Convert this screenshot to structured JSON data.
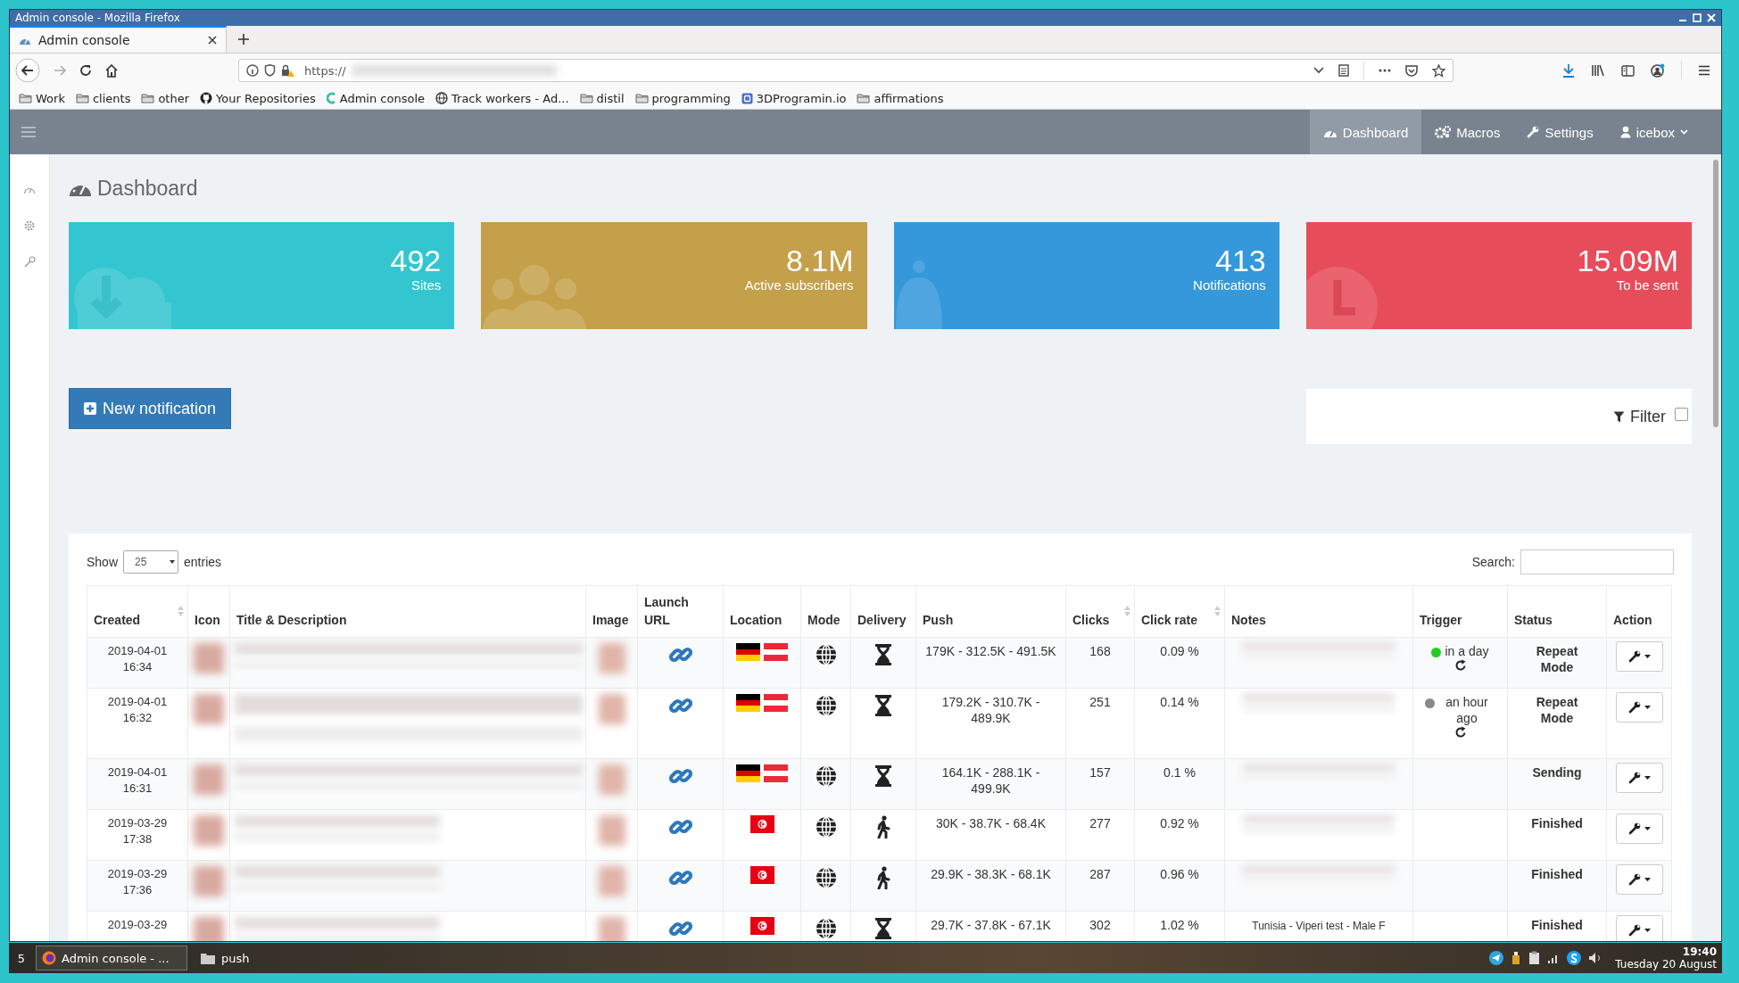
{
  "window": {
    "title": "Admin console - Mozilla Firefox"
  },
  "browser": {
    "tabs": [
      {
        "label": "Admin console",
        "selected": true
      }
    ],
    "url": "https://",
    "bookmarks": [
      {
        "label": "Work",
        "kind": "folder"
      },
      {
        "label": "clients",
        "kind": "folder"
      },
      {
        "label": "other",
        "kind": "folder"
      },
      {
        "label": "Your Repositories",
        "kind": "github"
      },
      {
        "label": "Admin console",
        "kind": "app"
      },
      {
        "label": "Track workers - Ad...",
        "kind": "globe"
      },
      {
        "label": "distil",
        "kind": "folder"
      },
      {
        "label": "programming",
        "kind": "folder"
      },
      {
        "label": "3DProgramin.io",
        "kind": "site"
      },
      {
        "label": "affirmations",
        "kind": "folder"
      }
    ]
  },
  "app": {
    "nav": [
      {
        "label": "Dashboard",
        "kind": "dashboard",
        "selected": true
      },
      {
        "label": "Macros",
        "kind": "macros",
        "selected": false
      },
      {
        "label": "Settings",
        "kind": "settings",
        "selected": false
      },
      {
        "label": "icebox",
        "kind": "user",
        "selected": false
      }
    ],
    "page_title": "Dashboard",
    "stats": [
      {
        "value": "492",
        "label": "Sites",
        "kind": "sites",
        "color": "#33c6d1"
      },
      {
        "value": "8.1M",
        "label": "Active subscribers",
        "kind": "subscribers",
        "color": "#c4a04a"
      },
      {
        "value": "413",
        "label": "Notifications",
        "kind": "notifications",
        "color": "#3498db"
      },
      {
        "value": "15.09M",
        "label": "To be sent",
        "kind": "queue",
        "color": "#e74c5a"
      }
    ],
    "new_button": "New notification",
    "filter": {
      "label": "Filter",
      "checked": false
    },
    "table": {
      "show_label": "Show",
      "page_size": "25",
      "entries_label": "entries",
      "search_label": "Search:",
      "columns": [
        {
          "label": "Created",
          "sortable": true
        },
        {
          "label": "Icon",
          "sortable": false
        },
        {
          "label": "Title & Description",
          "sortable": false
        },
        {
          "label": "Image",
          "sortable": false
        },
        {
          "label": "Launch URL",
          "sortable": false
        },
        {
          "label": "Location",
          "sortable": false
        },
        {
          "label": "Mode",
          "sortable": false
        },
        {
          "label": "Delivery",
          "sortable": false
        },
        {
          "label": "Push",
          "sortable": false
        },
        {
          "label": "Clicks",
          "sortable": true
        },
        {
          "label": "Click rate",
          "sortable": true
        },
        {
          "label": "Notes",
          "sortable": false
        },
        {
          "label": "Trigger",
          "sortable": false
        },
        {
          "label": "Status",
          "sortable": false
        },
        {
          "label": "Action",
          "sortable": false
        }
      ],
      "rows": [
        {
          "date": "2019-04-01",
          "time": "16:34",
          "flags": [
            {
              "kind": "germany"
            },
            {
              "kind": "austria"
            }
          ],
          "delivery": {
            "kind": "scheduled"
          },
          "push": "179K - 312.5K - 491.5K",
          "clicks": "168",
          "rate": "0.09 %",
          "trigger": {
            "text": "in a day",
            "color": "#22cc22",
            "repeat": true
          },
          "status": "Repeat Mode"
        },
        {
          "date": "2019-04-01",
          "time": "16:32",
          "flags": [
            {
              "kind": "germany"
            },
            {
              "kind": "austria"
            }
          ],
          "delivery": {
            "kind": "scheduled"
          },
          "push": "179.2K - 310.7K - 489.9K",
          "clicks": "251",
          "rate": "0.14 %",
          "trigger": {
            "text": "an hour ago",
            "color": "#888888",
            "repeat": true
          },
          "status": "Repeat Mode"
        },
        {
          "date": "2019-04-01",
          "time": "16:31",
          "flags": [
            {
              "kind": "germany"
            },
            {
              "kind": "austria"
            }
          ],
          "delivery": {
            "kind": "scheduled"
          },
          "push": "164.1K - 288.1K - 499.9K",
          "clicks": "157",
          "rate": "0.1 %",
          "status": "Sending"
        },
        {
          "date": "2019-03-29",
          "time": "17:38",
          "flags": [
            {
              "kind": "tunisia"
            }
          ],
          "delivery": {
            "kind": "immediate"
          },
          "push": "30K - 38.7K - 68.4K",
          "clicks": "277",
          "rate": "0.92 %",
          "status": "Finished"
        },
        {
          "date": "2019-03-29",
          "time": "17:36",
          "flags": [
            {
              "kind": "tunisia"
            }
          ],
          "delivery": {
            "kind": "immediate"
          },
          "push": "29.9K - 38.3K - 68.1K",
          "clicks": "287",
          "rate": "0.96 %",
          "status": "Finished"
        },
        {
          "date": "2019-03-29",
          "flags": [
            {
              "kind": "tunisia"
            }
          ],
          "delivery": {
            "kind": "scheduled"
          },
          "push": "29.7K - 37.8K - 67.1K",
          "clicks": "302",
          "rate": "1.02 %",
          "note": "Tunisia - Viperi test - Male F",
          "status": "Finished"
        }
      ]
    }
  },
  "taskbar": {
    "workspace": "5",
    "tasks": [
      {
        "label": "Admin console - ...",
        "kind": "browser",
        "selected": true
      },
      {
        "label": "push",
        "kind": "folder",
        "selected": false
      }
    ],
    "time": "19:40",
    "date": "Tuesday 20 August"
  }
}
